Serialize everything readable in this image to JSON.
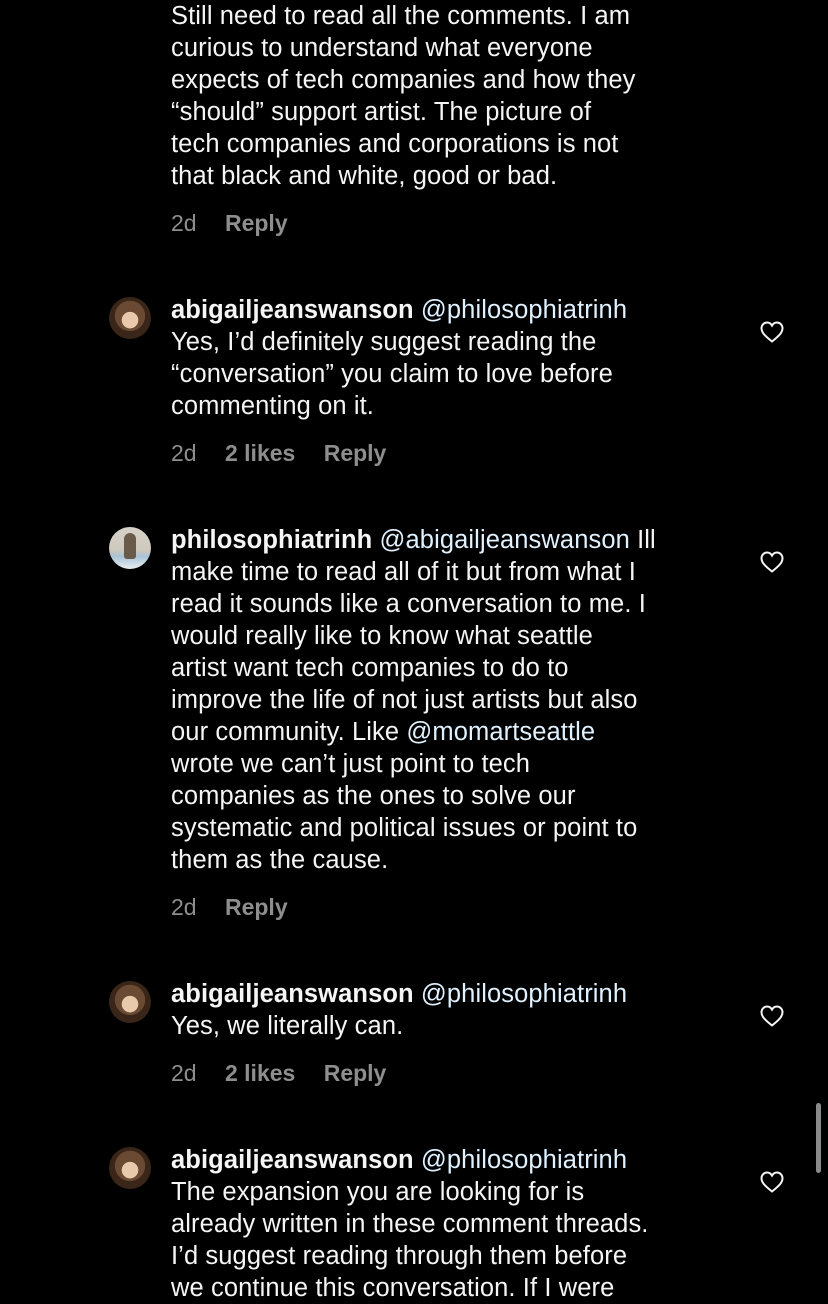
{
  "comments": [
    {
      "username": "",
      "mention": "",
      "text_lines": [
        "Still need to read all the comments. I am",
        "curious to understand what everyone",
        "expects of tech companies and how they",
        "“should” support artist. The picture of",
        "tech companies and corporations is not",
        "that black and white, good or bad."
      ],
      "time": "2d",
      "likes": "",
      "reply_label": "Reply"
    },
    {
      "username": "abigailjeanswanson",
      "mention": "@philosophiatrinh",
      "text_lines": [
        "Yes, I’d definitely suggest reading the",
        "“conversation” you claim to love before",
        "commenting on it."
      ],
      "time": "2d",
      "likes": "2 likes",
      "reply_label": "Reply"
    },
    {
      "username": "philosophiatrinh",
      "mention": "@abigailjeanswanson",
      "first_line_tail": " Ill",
      "text_lines": [
        "make time to read all of it but from what I",
        "read it sounds like a conversation to me. I",
        "would really like to know what seattle",
        "artist want tech companies to do to",
        "improve the life of not just artists but also",
        "our community. Like ",
        "wrote we can’t just point to tech",
        "companies as the ones to solve our",
        "systematic and political issues or point to",
        "them as the cause."
      ],
      "inline_mention": "@momartseattle",
      "time": "2d",
      "likes": "",
      "reply_label": "Reply"
    },
    {
      "username": "abigailjeanswanson",
      "mention": "@philosophiatrinh",
      "text_lines": [
        "Yes, we literally can."
      ],
      "time": "2d",
      "likes": "2 likes",
      "reply_label": "Reply"
    },
    {
      "username": "abigailjeanswanson",
      "mention": "@philosophiatrinh",
      "text_lines": [
        "The expansion you are looking for is",
        "already written in these comment threads.",
        "I’d suggest reading through them before",
        "we continue this conversation. If I were"
      ],
      "time": "",
      "likes": "",
      "reply_label": ""
    }
  ],
  "icons": {
    "like": "heart-outline-icon"
  },
  "colors": {
    "background": "#000000",
    "text": "#f5f5f5",
    "meta": "#8e8e8e",
    "mention": "#e0f1ff"
  }
}
